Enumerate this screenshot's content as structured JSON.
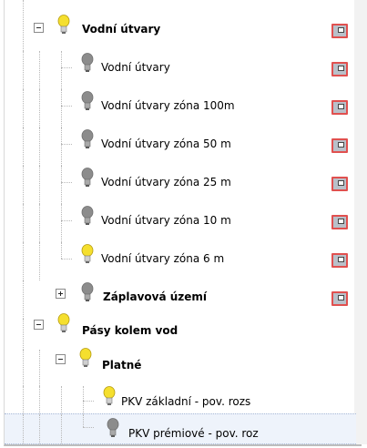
{
  "layer_tree": {
    "items": [
      {
        "label": "Vodní útvary",
        "bold": true,
        "bulb": "on",
        "expander": "minus",
        "legend": true
      },
      {
        "label": "Vodní útvary",
        "bold": false,
        "bulb": "off",
        "expander": "",
        "legend": true
      },
      {
        "label": "Vodní útvary zóna 100m",
        "bold": false,
        "bulb": "off",
        "expander": "",
        "legend": true
      },
      {
        "label": "Vodní útvary zóna 50 m",
        "bold": false,
        "bulb": "off",
        "expander": "",
        "legend": true
      },
      {
        "label": "Vodní útvary zóna 25 m",
        "bold": false,
        "bulb": "off",
        "expander": "",
        "legend": true
      },
      {
        "label": "Vodní útvary zóna 10 m",
        "bold": false,
        "bulb": "off",
        "expander": "",
        "legend": true
      },
      {
        "label": "Vodní útvary zóna 6 m",
        "bold": false,
        "bulb": "on",
        "expander": "",
        "legend": true
      },
      {
        "label": "Záplavová území",
        "bold": true,
        "bulb": "off",
        "expander": "plus",
        "legend": true
      },
      {
        "label": "Pásy kolem vod",
        "bold": true,
        "bulb": "on",
        "expander": "minus",
        "legend": false
      },
      {
        "label": "Platné",
        "bold": true,
        "bulb": "on",
        "expander": "minus",
        "legend": false
      },
      {
        "label": "PKV základní - pov. rozs",
        "bold": false,
        "bulb": "on",
        "expander": "",
        "legend": false
      },
      {
        "label": "PKV prémiové - pov. roz",
        "bold": false,
        "bulb": "off",
        "expander": "",
        "legend": false,
        "selected": true
      }
    ]
  },
  "colors": {
    "bulb_on": "#f5df2e",
    "bulb_off": "#8c8c8c",
    "legend_border": "#e0504f",
    "selection_bg": "#eef3fb"
  }
}
